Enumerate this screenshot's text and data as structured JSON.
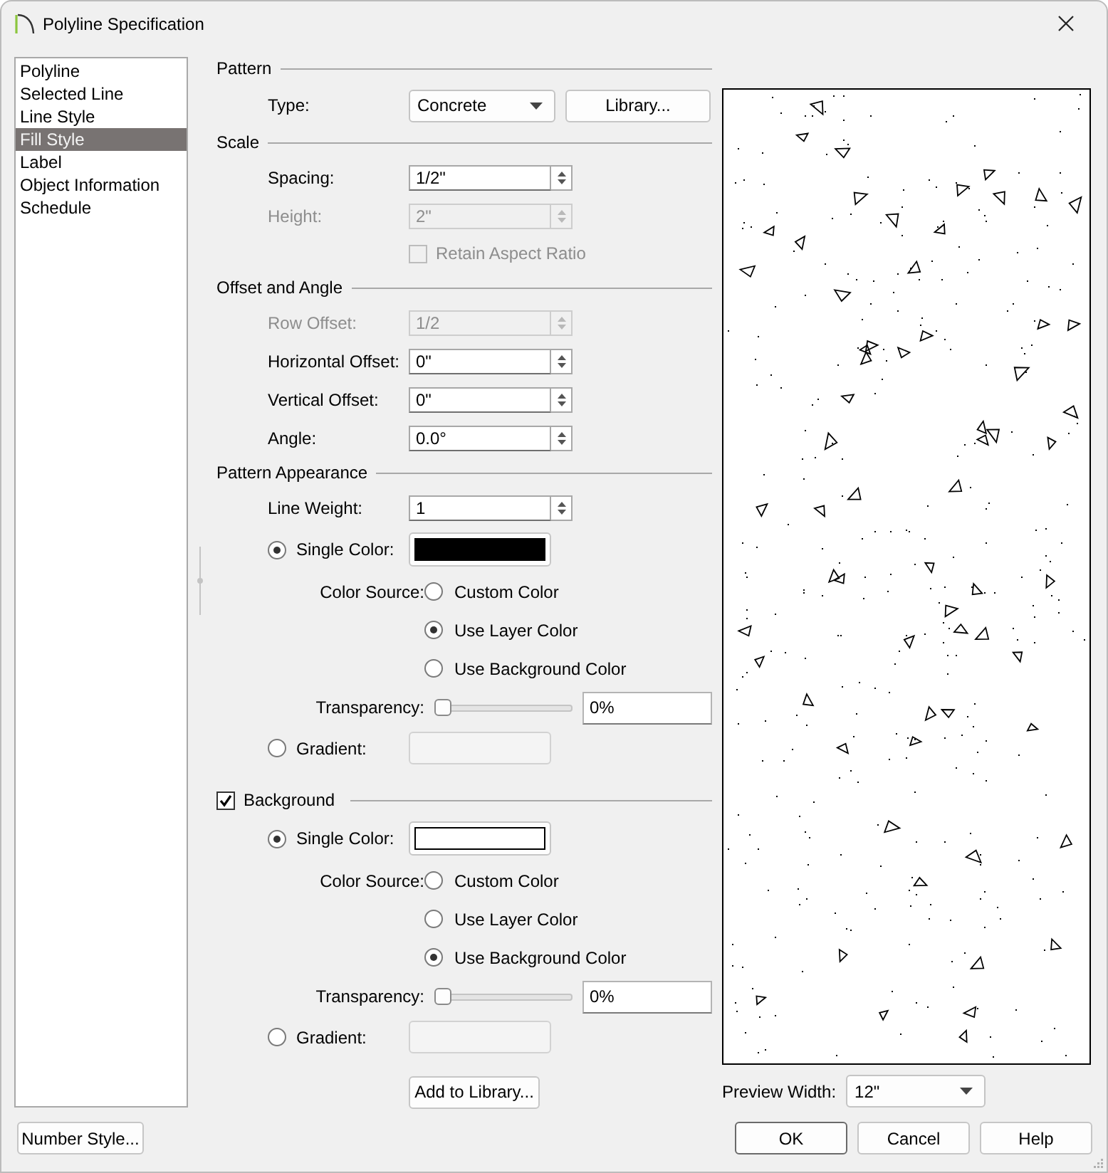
{
  "window": {
    "title": "Polyline Specification"
  },
  "sidebar": {
    "items": [
      {
        "label": "Polyline",
        "selected": false
      },
      {
        "label": "Selected Line",
        "selected": false
      },
      {
        "label": "Line Style",
        "selected": false
      },
      {
        "label": "Fill Style",
        "selected": true
      },
      {
        "label": "Label",
        "selected": false
      },
      {
        "label": "Object Information",
        "selected": false
      },
      {
        "label": "Schedule",
        "selected": false
      }
    ]
  },
  "sections": [
    {
      "kind": "group",
      "heading": "Pattern",
      "rows": [
        {
          "kind": "dropdown",
          "label": "Type:",
          "value": "Concrete",
          "button": "Library..."
        }
      ]
    },
    {
      "kind": "group",
      "heading": "Scale",
      "rows": [
        {
          "kind": "spin",
          "label": "Spacing:",
          "value": "1/2\"",
          "disabled": false
        },
        {
          "kind": "spin",
          "label": "Height:",
          "value": "2\"",
          "disabled": true
        },
        {
          "kind": "checkbox",
          "label": "Retain Aspect Ratio",
          "checked": false,
          "disabled": true
        }
      ]
    },
    {
      "kind": "group",
      "heading": "Offset and Angle",
      "rows": [
        {
          "kind": "spin",
          "label": "Row Offset:",
          "value": "1/2",
          "disabled": true
        },
        {
          "kind": "spin",
          "label": "Horizontal Offset:",
          "value": "0\"",
          "disabled": false
        },
        {
          "kind": "spin",
          "label": "Vertical Offset:",
          "value": "0\"",
          "disabled": false
        },
        {
          "kind": "spin",
          "label": "Angle:",
          "value": "0.0°",
          "disabled": false
        }
      ]
    },
    {
      "kind": "group",
      "heading": "Pattern Appearance",
      "rows": [
        {
          "kind": "spin",
          "label": "Line Weight:",
          "value": "1",
          "disabled": false
        },
        {
          "kind": "color",
          "label": "Single Color:",
          "selected": true,
          "color": "#000000"
        },
        {
          "kind": "source",
          "label": "Color Source:",
          "options": [
            {
              "label": "Custom Color",
              "selected": false
            },
            {
              "label": "Use Layer Color",
              "selected": true
            },
            {
              "label": "Use Background Color",
              "selected": false
            }
          ]
        },
        {
          "kind": "slider",
          "label": "Transparency:",
          "level": 0,
          "value": "0%"
        },
        {
          "kind": "gradient",
          "label": "Gradient:",
          "selected": false
        }
      ]
    },
    {
      "kind": "check_group",
      "heading": "Background",
      "checked": true,
      "rows": [
        {
          "kind": "color",
          "label": "Single Color:",
          "selected": true,
          "color": "#ffffff"
        },
        {
          "kind": "source",
          "label": "Color Source:",
          "options": [
            {
              "label": "Custom Color",
              "selected": false
            },
            {
              "label": "Use Layer Color",
              "selected": false
            },
            {
              "label": "Use Background Color",
              "selected": true
            }
          ]
        },
        {
          "kind": "slider",
          "label": "Transparency:",
          "level": 0,
          "value": "0%"
        },
        {
          "kind": "gradient",
          "label": "Gradient:",
          "selected": false
        },
        {
          "kind": "button",
          "label": "Add to Library..."
        }
      ]
    }
  ],
  "preview": {
    "label": "Preview Width:",
    "value": "12\""
  },
  "footer": {
    "left_button": "Number Style...",
    "buttons": [
      {
        "label": "OK",
        "default": true
      },
      {
        "label": "Cancel",
        "default": false
      },
      {
        "label": "Help",
        "default": false
      }
    ]
  }
}
